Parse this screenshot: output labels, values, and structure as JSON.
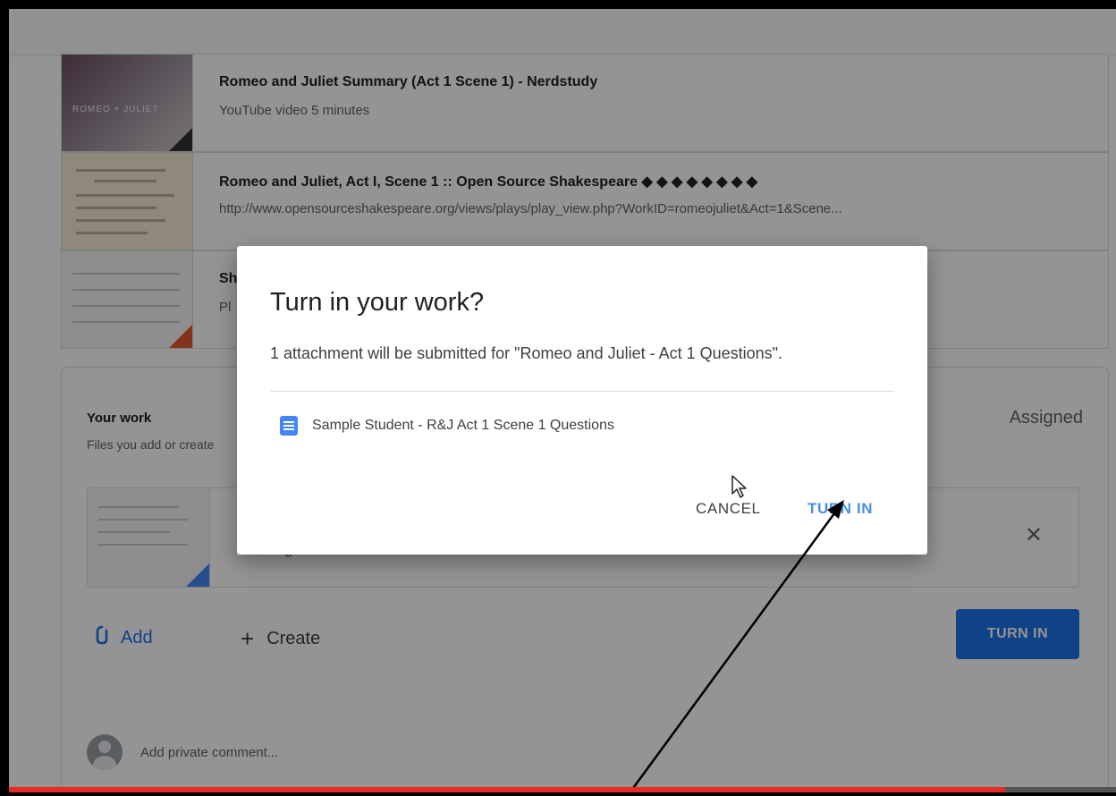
{
  "materials": [
    {
      "title": "Romeo and Juliet Summary (Act 1 Scene 1) - Nerdstudy",
      "subtitle": "YouTube video  5 minutes",
      "thumbnail_text": "ROMEO + JULIET"
    },
    {
      "title": "Romeo and Juliet, Act I, Scene 1 :: Open Source Shakespeare ◆ ◆ ◆ ◆ ◆ ◆ ◆ ◆",
      "subtitle": "http://www.opensourceshakespeare.org/views/plays/play_view.php?WorkID=romeojuliet&Act=1&Scene..."
    },
    {
      "title": "Sh",
      "subtitle": "Pl"
    }
  ],
  "your_work": {
    "title": "Your work",
    "subtitle": "Files you add or create",
    "status": "Assigned",
    "attachment_name": "Google Docs",
    "add_label": "Add",
    "create_label": "Create",
    "turn_in_label": "TURN IN",
    "comment_placeholder": "Add private comment..."
  },
  "dialog": {
    "title": "Turn in your work?",
    "message": "1 attachment will be submitted for \"Romeo and Juliet - Act 1 Questions\".",
    "attachment_name": "Sample Student - R&J Act 1 Scene 1 Questions",
    "cancel_label": "CANCEL",
    "turn_in_label": "TURN IN"
  },
  "video_progress": 0.9,
  "colors": {
    "accent": "#1a73e8",
    "docs_blue": "#4285f4",
    "progress_red": "#e52d27"
  }
}
